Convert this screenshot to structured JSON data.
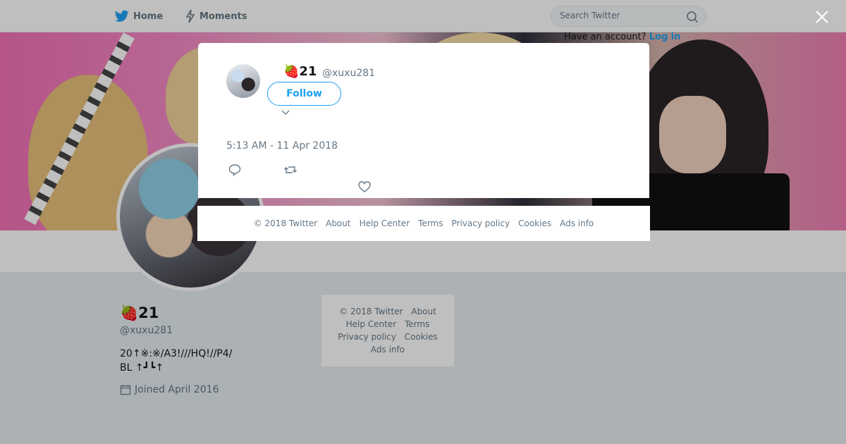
{
  "nav": {
    "home_label": "Home",
    "moments_label": "Moments",
    "search_placeholder": "Search Twitter",
    "login_prompt": "Have an account?",
    "login_link": "Log in"
  },
  "profile": {
    "name_prefix": "",
    "name_emoji": "🍓",
    "name_suffix": "21",
    "handle": "@xuxu281",
    "bio_line1": "20↑※:※/A3!///HQ!//P4/",
    "bio_line2": "BL ↑┛┗↑",
    "joined": "Joined April 2016"
  },
  "side_footer": {
    "copyright": "© 2018 Twitter",
    "about": "About",
    "help": "Help Center",
    "terms": "Terms",
    "privacy": "Privacy policy",
    "cookies": "Cookies",
    "ads": "Ads info"
  },
  "tweet": {
    "name_emoji": "🍓",
    "name": "21",
    "handle": "@xuxu281",
    "follow_label": "Follow",
    "text": "",
    "timestamp": "5:13 AM - 11 Apr 2018"
  },
  "modal_footer": {
    "copyright": "© 2018 Twitter",
    "about": "About",
    "help": "Help Center",
    "terms": "Terms",
    "privacy": "Privacy policy",
    "cookies": "Cookies",
    "ads": "Ads info"
  },
  "colors": {
    "brand": "#1da1f2",
    "text": "#14171a",
    "muted": "#657786",
    "background": "#e6ecf0"
  },
  "icons": {
    "home": "twitter-bird-icon",
    "moments": "lightning-icon",
    "search": "search-icon",
    "close": "close-icon",
    "calendar": "calendar-icon",
    "reply": "reply-icon",
    "retweet": "retweet-icon",
    "like": "heart-icon",
    "chevron": "chevron-down-icon"
  }
}
